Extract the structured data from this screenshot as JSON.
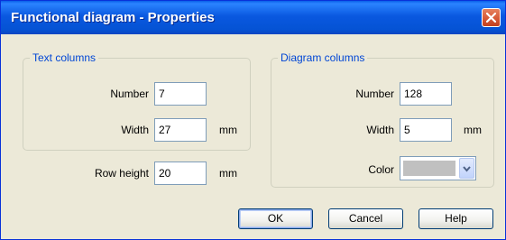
{
  "window": {
    "title": "Functional diagram - Properties",
    "accent_color": "#0a5fe8",
    "close_icon": "close-icon"
  },
  "text_columns": {
    "legend": "Text columns",
    "number_label": "Number",
    "number_value": "7",
    "width_label": "Width",
    "width_value": "27",
    "width_unit": "mm"
  },
  "row_height": {
    "label": "Row height",
    "value": "20",
    "unit": "mm"
  },
  "diagram_columns": {
    "legend": "Diagram columns",
    "number_label": "Number",
    "number_value": "128",
    "width_label": "Width",
    "width_value": "5",
    "width_unit": "mm",
    "color_label": "Color",
    "color_value": "#c0c0c0",
    "dropdown_icon": "chevron-down-icon"
  },
  "buttons": {
    "ok": "OK",
    "cancel": "Cancel",
    "help": "Help"
  }
}
